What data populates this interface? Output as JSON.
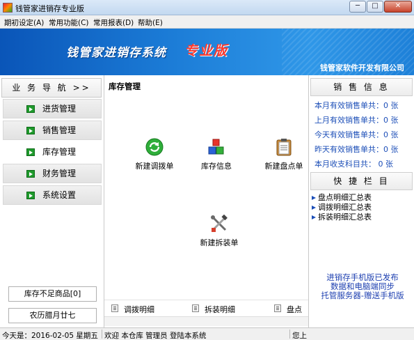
{
  "window": {
    "title": "钱管家进销存专业版",
    "min_label": "─",
    "max_label": "□",
    "close_label": "✕"
  },
  "menu": [
    "期初设定(A)",
    "常用功能(C)",
    "常用报表(D)",
    "帮助(E)"
  ],
  "banner": {
    "title": "钱管家进销存系统",
    "edition": "专业版",
    "company": "钱管家软件开发有限公司"
  },
  "nav": {
    "header": "业 务 导 航  >>",
    "items": [
      "进货管理",
      "销售管理",
      "库存管理",
      "财务管理",
      "系统设置"
    ],
    "active_index": 2,
    "stock_shortage": "库存不足商品[0]",
    "lunar_date": "农历腊月廿七"
  },
  "main": {
    "title": "库存管理",
    "modules": [
      "新建调拨单",
      "库存信息",
      "新建盘点单",
      "新建拆装单"
    ],
    "bottom_tabs": [
      "调拨明细",
      "拆装明细",
      "盘点明"
    ]
  },
  "sales": {
    "header": "销 售 信 息",
    "rows": [
      "本月有效销售单共：0 张",
      "上月有效销售单共：0 张",
      "今天有效销售单共：0 张",
      "昨天有效销售单共：0 张",
      "本月收支科目共： 0 张"
    ]
  },
  "quick": {
    "header": "快 捷 栏 目",
    "items": [
      "盘点明细汇总表",
      "调拨明细汇总表",
      "拆装明细汇总表"
    ]
  },
  "promo": [
    "进销存手机版已发布",
    "数据和电脑端同步",
    "托管服务器-赠送手机版"
  ],
  "status": {
    "date": "今天是：2016-02-05  星期五",
    "welcome": "欢迎 本仓库 管理员  登陆本系统",
    "tail": "您上"
  },
  "colors": {
    "banner_blue": "#1b7bd6",
    "edition_red": "#ff3b2f",
    "link_blue": "#1d4fb8",
    "nav_arrow_green": "#1f9a2c"
  }
}
